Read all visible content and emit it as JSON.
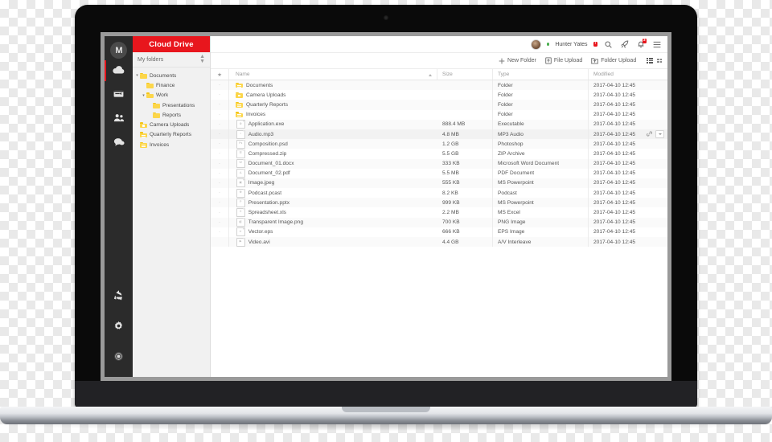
{
  "app": {
    "brand": "Cloud Drive",
    "logo_letter": "M",
    "accent_red": "#e8161d",
    "folder_yellow": "#fcd64a"
  },
  "rail": {
    "items": [
      {
        "name": "logo",
        "label": "M"
      },
      {
        "name": "cloud-drive",
        "label": "Cloud Drive"
      },
      {
        "name": "inbox",
        "label": "Inbox"
      },
      {
        "name": "contacts",
        "label": "Contacts"
      },
      {
        "name": "chat",
        "label": "Chat"
      }
    ],
    "bottom_items": [
      {
        "name": "sync",
        "label": "Sync"
      },
      {
        "name": "settings",
        "label": "Settings"
      },
      {
        "name": "account",
        "label": "Account"
      }
    ]
  },
  "sidebar": {
    "title": "My folders",
    "tree": [
      {
        "label": "Documents",
        "depth": 0,
        "caret": "▾",
        "icon": "folder"
      },
      {
        "label": "Finance",
        "depth": 1,
        "caret": "",
        "icon": "folder"
      },
      {
        "label": "Work",
        "depth": 1,
        "caret": "▾",
        "icon": "folder"
      },
      {
        "label": "Presentations",
        "depth": 2,
        "caret": "",
        "icon": "folder"
      },
      {
        "label": "Reports",
        "depth": 2,
        "caret": "",
        "icon": "folder"
      },
      {
        "label": "Camera Uploads",
        "depth": 0,
        "caret": "",
        "icon": "folder-camera"
      },
      {
        "label": "Quarterly Reports",
        "depth": 0,
        "caret": "",
        "icon": "folder-docs"
      },
      {
        "label": "Invoices",
        "depth": 0,
        "caret": "",
        "icon": "folder-docs"
      }
    ]
  },
  "header": {
    "username": "Hunter Yates",
    "user_badge": "!",
    "status": "online",
    "notification_count": "3",
    "icons": [
      "search-icon",
      "rocket-icon",
      "bell-icon",
      "hamburger-icon"
    ]
  },
  "toolbar": {
    "new_folder": "New Folder",
    "file_upload": "File Upload",
    "folder_upload": "Folder Upload",
    "view_list": "List view",
    "view_grid": "Grid view"
  },
  "table": {
    "columns": {
      "star": "★",
      "name": "Name",
      "size": "Size",
      "type": "Type",
      "modified": "Modified"
    },
    "sort": "name-asc",
    "rows": [
      {
        "star": "·",
        "name": "Documents",
        "size": "",
        "type": "Folder",
        "modified": "2017-04-10 12:45",
        "icon": "folder-docs",
        "hover": false
      },
      {
        "star": "·",
        "name": "Camera Uploads",
        "size": "",
        "type": "Folder",
        "modified": "2017-04-10 12:45",
        "icon": "folder-camera",
        "hover": false
      },
      {
        "star": "·",
        "name": "Quarterly Reports",
        "size": "",
        "type": "Folder",
        "modified": "2017-04-10 12:45",
        "icon": "folder-docs",
        "hover": false
      },
      {
        "star": "·",
        "name": "Invoices",
        "size": "",
        "type": "Folder",
        "modified": "2017-04-10 12:45",
        "icon": "folder-docs",
        "hover": false
      },
      {
        "star": "·",
        "name": "Application.exe",
        "size": "888.4 MB",
        "type": "Executable",
        "modified": "2017-04-10 12:45",
        "icon": "file-exe",
        "glyph": "⚙",
        "hover": false
      },
      {
        "star": "·",
        "name": "Audio.mp3",
        "size": "4.8 MB",
        "type": "MP3 Audio",
        "modified": "2017-04-10 12:45",
        "icon": "file-mp3",
        "glyph": "♪",
        "hover": true
      },
      {
        "star": "·",
        "name": "Composition.psd",
        "size": "1.2 GB",
        "type": "Photoshop",
        "modified": "2017-04-10 12:45",
        "icon": "file-psd",
        "glyph": "Ps",
        "hover": false
      },
      {
        "star": "·",
        "name": "Compressed.zip",
        "size": "5.5 GB",
        "type": "ZIP Archive",
        "modified": "2017-04-10 12:45",
        "icon": "file-zip",
        "glyph": "☰",
        "hover": false
      },
      {
        "star": "·",
        "name": "Document_01.docx",
        "size": "333 KB",
        "type": "Microsoft Word Document",
        "modified": "2017-04-10 12:45",
        "icon": "file-docx",
        "glyph": "W",
        "hover": false
      },
      {
        "star": "·",
        "name": "Document_02.pdf",
        "size": "5.5 MB",
        "type": "PDF Document",
        "modified": "2017-04-10 12:45",
        "icon": "file-pdf",
        "glyph": "A",
        "hover": false
      },
      {
        "star": "·",
        "name": "Image.jpeg",
        "size": "555 KB",
        "type": "MS Powerpoint",
        "modified": "2017-04-10 12:45",
        "icon": "file-jpeg",
        "glyph": "▣",
        "hover": false
      },
      {
        "star": "·",
        "name": "Podcast.pcast",
        "size": "8.2 KB",
        "type": "Podcast",
        "modified": "2017-04-10 12:45",
        "icon": "file-pcast",
        "glyph": "☸",
        "hover": false
      },
      {
        "star": "·",
        "name": "Presentation.pptx",
        "size": "999 KB",
        "type": "MS Powerpoint",
        "modified": "2017-04-10 12:45",
        "icon": "file-pptx",
        "glyph": "P",
        "hover": false
      },
      {
        "star": "·",
        "name": "Spreadsheet.xls",
        "size": "2.2 MB",
        "type": "MS Excel",
        "modified": "2017-04-10 12:45",
        "icon": "file-xls",
        "glyph": "X",
        "hover": false
      },
      {
        "star": "·",
        "name": "Transparent Image.png",
        "size": "700 KB",
        "type": "PNG Image",
        "modified": "2017-04-10 12:45",
        "icon": "file-png",
        "glyph": "◧",
        "hover": false
      },
      {
        "star": "·",
        "name": "Vector.eps",
        "size": "666 KB",
        "type": "EPS Image",
        "modified": "2017-04-10 12:45",
        "icon": "file-eps",
        "glyph": "✒",
        "hover": false
      },
      {
        "star": "",
        "name": "Video.avi",
        "size": "4.4 GB",
        "type": "A/V Interleave",
        "modified": "2017-04-10 12:45",
        "icon": "file-avi",
        "glyph": "▶",
        "hover": false
      }
    ],
    "row_actions": {
      "link": "copy-link",
      "menu": "row-menu"
    }
  }
}
